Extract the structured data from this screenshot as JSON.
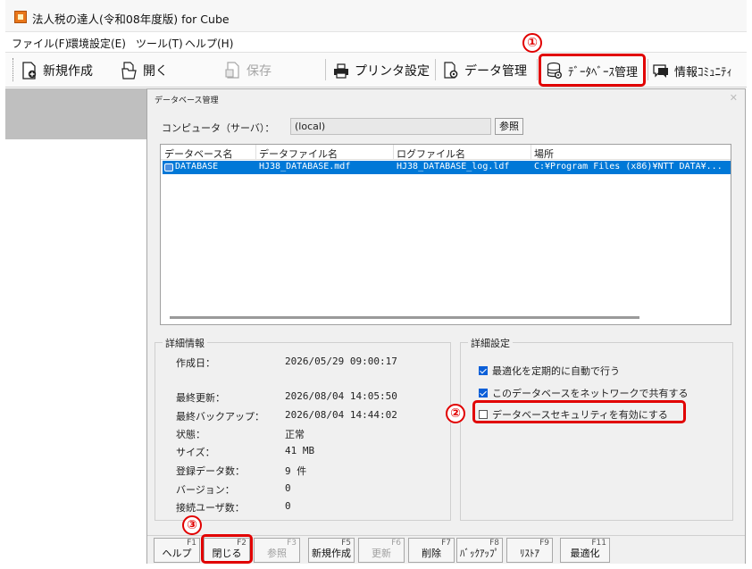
{
  "app": {
    "title": "法人税の達人(令和08年度版) for Cube"
  },
  "menu": [
    "ファイル(F)",
    "環境設定(E)",
    "ツール(T)",
    "ヘルプ(H)"
  ],
  "toolbar": {
    "new": "新規作成",
    "open": "開く",
    "save": "保存",
    "printer": "プリンタ設定",
    "data_mgmt": "データ管理",
    "db_mgmt": "ﾃﾞｰﾀﾍﾞｰｽ管理",
    "community": "情報ｺﾐｭﾆﾃｨ"
  },
  "annotations": {
    "n1": "①",
    "n2": "②",
    "n3": "③"
  },
  "dialog": {
    "title": "データベース管理",
    "computer_label": "コンピュータ（サーバ）：",
    "computer_value": "(local)",
    "browse": "参照",
    "columns": [
      "データベース名",
      "データファイル名",
      "ログファイル名",
      "場所"
    ],
    "rows": [
      {
        "name": "DATABASE",
        "data_file": "HJ38_DATABASE.mdf",
        "log_file": "HJ38_DATABASE_log.ldf",
        "location": "C:¥Program Files (x86)¥NTT DATA¥..."
      }
    ],
    "details": {
      "title": "詳細情報",
      "items": [
        {
          "label": "作成日：",
          "value": "2026/05/29 09:00:17"
        },
        {
          "label": "最終更新：",
          "value": "2026/08/04 14:05:50"
        },
        {
          "label": "最終バックアップ：",
          "value": "2026/08/04 14:44:02"
        },
        {
          "label": "状態：",
          "value": "正常"
        },
        {
          "label": "サイズ：",
          "value": "41 MB"
        },
        {
          "label": "登録データ数：",
          "value": "9 件"
        },
        {
          "label": "バージョン：",
          "value": "0"
        },
        {
          "label": "接続ユーザ数：",
          "value": "0"
        }
      ]
    },
    "settings": {
      "title": "詳細設定",
      "options": [
        {
          "label": "最適化を定期的に自動で行う",
          "checked": true
        },
        {
          "label": "このデータベースをネットワークで共有する",
          "checked": true
        },
        {
          "label": "データベースセキュリティを有効にする",
          "checked": false
        }
      ]
    },
    "fkeys": [
      {
        "code": "F1",
        "label": "ヘルプ",
        "enabled": true
      },
      {
        "code": "F2",
        "label": "閉じる",
        "enabled": true
      },
      {
        "code": "F3",
        "label": "参照",
        "enabled": false
      },
      {
        "code": "F5",
        "label": "新規作成",
        "enabled": true
      },
      {
        "code": "F6",
        "label": "更新",
        "enabled": false
      },
      {
        "code": "F7",
        "label": "削除",
        "enabled": true
      },
      {
        "code": "F8",
        "label": "ﾊﾞｯｸｱｯﾌﾟ",
        "enabled": true
      },
      {
        "code": "F9",
        "label": "ﾘｽﾄｱ",
        "enabled": true
      },
      {
        "code": "F11",
        "label": "最適化",
        "enabled": true
      }
    ]
  },
  "colors": {
    "accent": "#0078d7",
    "highlight": "#e10000"
  }
}
